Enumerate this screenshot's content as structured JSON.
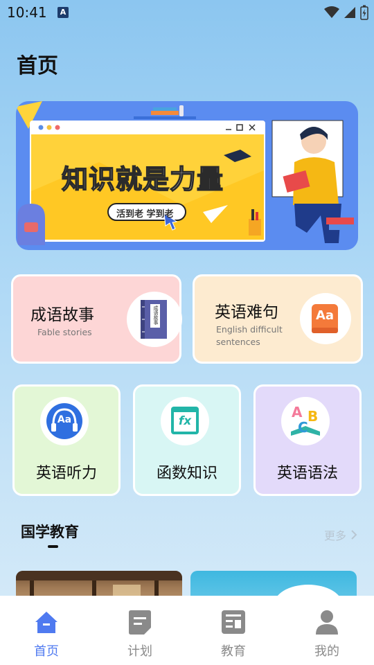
{
  "status_bar": {
    "time": "10:41",
    "notif_letter": "A"
  },
  "header": {
    "title": "首页"
  },
  "banner": {
    "headline": "知识就是力量",
    "slogan": "活到老 学到老"
  },
  "feature_cards": [
    {
      "title": "成语故事",
      "subtitle": "Fable stories",
      "book_text": "成语故事"
    },
    {
      "title": "英语难句",
      "subtitle_line1": "English difficult",
      "subtitle_line2": "sentences",
      "icon_text": "Aa"
    }
  ],
  "category_cards": [
    {
      "title": "英语听力",
      "icon_text": "Aa"
    },
    {
      "title": "函数知识",
      "icon_text": "fx"
    },
    {
      "title": "英语语法",
      "icon_text_a": "A",
      "icon_text_b": "B",
      "icon_text_c": "C"
    }
  ],
  "section": {
    "title": "国学教育",
    "more": "更多"
  },
  "bottom_nav": [
    {
      "label": "首页",
      "active": true
    },
    {
      "label": "计划",
      "active": false
    },
    {
      "label": "教育",
      "active": false
    },
    {
      "label": "我的",
      "active": false
    }
  ],
  "colors": {
    "accent": "#4f7af0",
    "inactive": "#8a8a8a"
  }
}
